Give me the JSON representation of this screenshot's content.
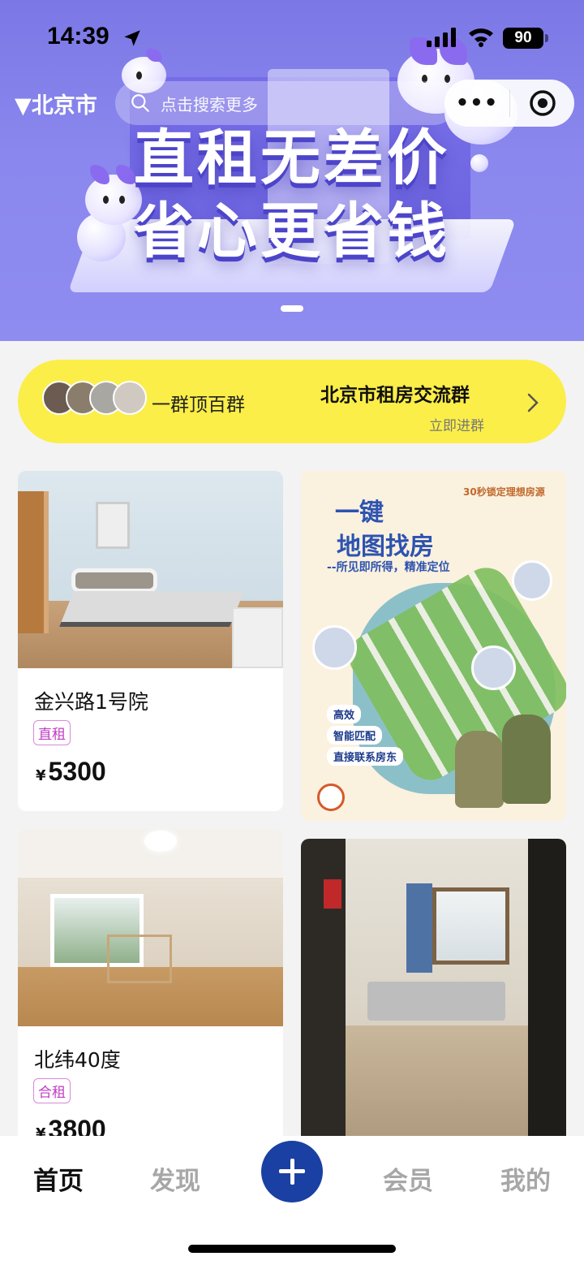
{
  "status_bar": {
    "time": "14:39",
    "battery": "90"
  },
  "banner": {
    "line1": "直租无差价",
    "line2": "省心更省钱"
  },
  "top_nav": {
    "city": "▼北京市",
    "search_placeholder": "点击搜索更多",
    "more_label": "•••"
  },
  "group_banner": {
    "slogan": "一群顶百群",
    "group_name": "北京市租房交流群",
    "action": "立即进群"
  },
  "listings": [
    {
      "title": "金兴路1号院",
      "tag": "直租",
      "currency": "¥",
      "price": "5300"
    },
    {
      "title": "北纬40度",
      "tag": "合租",
      "currency": "¥",
      "price": "3800"
    }
  ],
  "map_promo": {
    "hint": "30秒锁定理想房源",
    "line1": "一键",
    "line2": "地图找房",
    "subtitle": "--所见即所得，精准定位",
    "features": [
      "高效",
      "智能匹配",
      "直接联系房东"
    ]
  },
  "tabs": {
    "home": "首页",
    "discover": "发现",
    "vip": "会员",
    "mine": "我的"
  },
  "colors": {
    "accent": "#1a40a3",
    "group_bg": "#fbee48",
    "banner": "#7b78e6",
    "tag": "#c13cc2"
  }
}
